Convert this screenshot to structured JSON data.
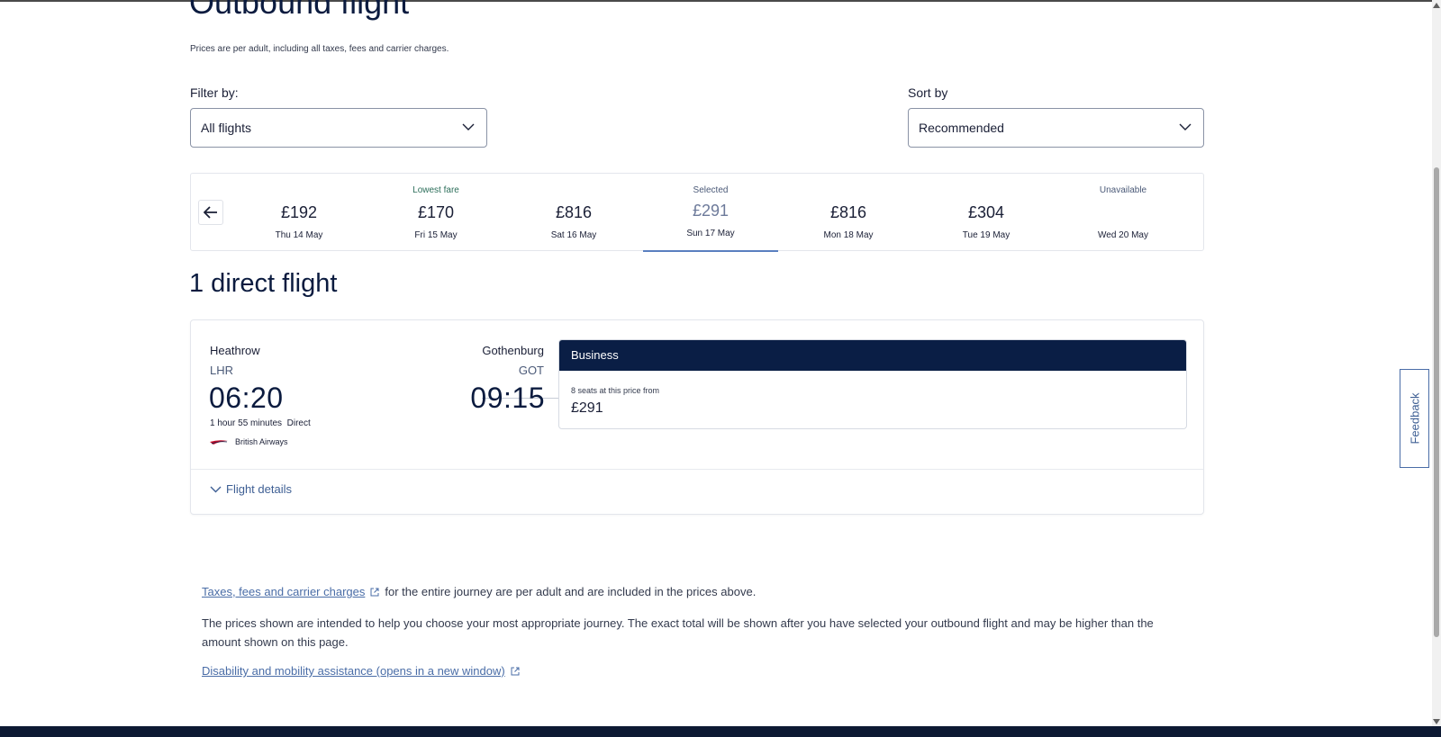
{
  "page": {
    "title": "Outbound flight",
    "subtitle": "Prices are per adult, including all taxes, fees and carrier charges."
  },
  "filter": {
    "label": "Filter by:",
    "value": "All flights"
  },
  "sort": {
    "label": "Sort by",
    "value": "Recommended"
  },
  "dates": [
    {
      "tag": "",
      "price": "£192",
      "date": "Thu 14 May",
      "selected": false
    },
    {
      "tag": "Lowest fare",
      "price": "£170",
      "date": "Fri 15 May",
      "selected": false
    },
    {
      "tag": "",
      "price": "£816",
      "date": "Sat 16 May",
      "selected": false
    },
    {
      "tag": "Selected",
      "price": "£291",
      "date": "Sun 17 May",
      "selected": true
    },
    {
      "tag": "",
      "price": "£816",
      "date": "Mon 18 May",
      "selected": false
    },
    {
      "tag": "",
      "price": "£304",
      "date": "Tue 19 May",
      "selected": false
    },
    {
      "tag": "Unavailable",
      "price": "",
      "date": "Wed 20 May",
      "selected": false
    }
  ],
  "results": {
    "title": "1 direct flight"
  },
  "flight": {
    "origin_city": "Heathrow",
    "origin_code": "LHR",
    "depart_time": "06:20",
    "dest_city": "Gothenburg",
    "dest_code": "GOT",
    "arrive_time": "09:15",
    "duration": "1 hour 55 minutes",
    "stops": "Direct",
    "airline": "British Airways",
    "fare": {
      "cabin": "Business",
      "seats": "8 seats at this price from",
      "price": "£291"
    },
    "details_label": "Flight details"
  },
  "notes": {
    "taxes_link": "Taxes, fees and carrier charges",
    "taxes_text": "for the entire journey are per adult and are included in the prices above.",
    "prices_text": "The prices shown are intended to help you choose your most appropriate journey. The exact total will be shown after you have selected your outbound flight and may be higher than the amount shown on this page.",
    "disability_link": "Disability and mobility assistance (opens in a new window)"
  },
  "feedback": {
    "label": "Feedback"
  },
  "colors": {
    "navy": "#0a1e45",
    "link": "#4a6da7",
    "selected_underline": "#5a7fc0",
    "ba_red": "#c8102e"
  }
}
